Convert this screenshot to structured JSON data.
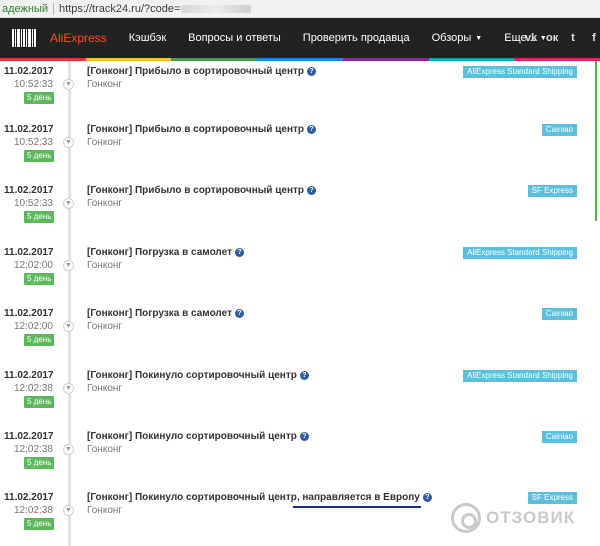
{
  "browser": {
    "secure_label": "адежный",
    "url": "https://track24.ru/?code="
  },
  "nav": {
    "brand": "AliExpress",
    "items": [
      "Кэшбэк",
      "Вопросы и ответы",
      "Проверить продавца"
    ],
    "dropdowns": [
      "Обзоры",
      "Еще..."
    ],
    "social": [
      "vk-icon",
      "odnoklassniki-icon",
      "twitter-icon",
      "facebook-icon"
    ],
    "social_glyphs": [
      "vk",
      "ок",
      "t",
      "f"
    ]
  },
  "colors": {
    "nav_bg": "#222222",
    "brand": "#ff4e20",
    "age_badge": "#5cb85c",
    "carrier_badge": "#5bc0de",
    "help_icon": "#2f5c9c"
  },
  "events": [
    {
      "date": "11.02.2017",
      "time": "10:52:33",
      "age": "5 день",
      "title": "[Гонконг] Прибыло в сортировочный центр",
      "place": "Гонконг",
      "carrier": "AliExpress Standard Shipping"
    },
    {
      "date": "11.02.2017",
      "time": "10:52:33",
      "age": "5 день",
      "title": "[Гонконг] Прибыло в сортировочный центр",
      "place": "Гонконг",
      "carrier": "Cainiao"
    },
    {
      "date": "11.02.2017",
      "time": "10:52:33",
      "age": "5 день",
      "title": "[Гонконг] Прибыло в сортировочный центр",
      "place": "Гонконг",
      "carrier": "SF Express"
    },
    {
      "date": "11.02.2017",
      "time": "12:02:00",
      "age": "5 день",
      "title": "[Гонконг] Погрузка в самолет",
      "place": "Гонконг",
      "carrier": "AliExpress Standard Shipping"
    },
    {
      "date": "11.02.2017",
      "time": "12:02:00",
      "age": "5 день",
      "title": "[Гонконг] Погрузка в самолет",
      "place": "Гонконг",
      "carrier": "Cainiao"
    },
    {
      "date": "11.02.2017",
      "time": "12:02:38",
      "age": "5 день",
      "title": "[Гонконг] Покинуло сортировочный центр",
      "place": "Гонконг",
      "carrier": "AliExpress Standard Shipping"
    },
    {
      "date": "11.02.2017",
      "time": "12:02:38",
      "age": "5 день",
      "title": "[Гонконг] Покинуло сортировочный центр",
      "place": "Гонконг",
      "carrier": "Cainiao"
    },
    {
      "date": "11.02.2017",
      "time": "12:02:38",
      "age": "5 день",
      "title": "[Гонконг] Покинуло сортировочный центр, направляется в Европу",
      "place": "Гонконг",
      "carrier": "SF Express"
    }
  ],
  "watermark": "ОТЗОВИК"
}
